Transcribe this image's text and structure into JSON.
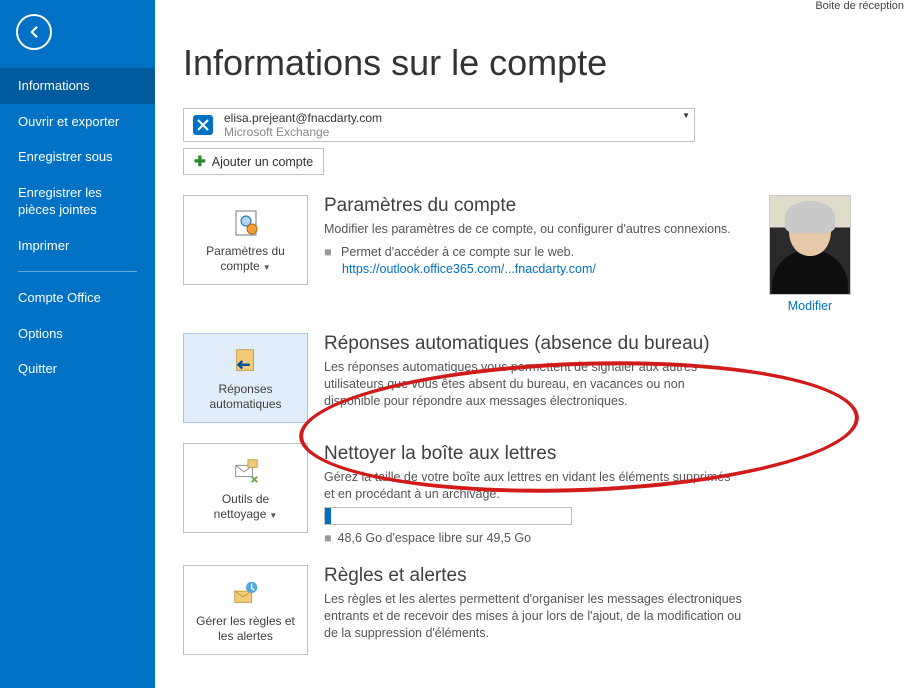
{
  "topRight": "Boite de réception",
  "sidebar": {
    "items": [
      "Informations",
      "Ouvrir et exporter",
      "Enregistrer sous",
      "Enregistrer les pièces jointes",
      "Imprimer",
      "Compte Office",
      "Options",
      "Quitter"
    ]
  },
  "title": "Informations sur le compte",
  "account": {
    "email": "elisa.prejeant@fnacdarty.com",
    "type": "Microsoft Exchange",
    "addBtn": "Ajouter un compte"
  },
  "avatar": {
    "modifyLink": "Modifier"
  },
  "secSettings": {
    "btn": "Paramètres du compte",
    "title": "Paramètres du compte",
    "desc": "Modifier les paramètres de ce compte, ou configurer d'autres connexions.",
    "bullet": "Permet d'accéder à ce compte sur le web.",
    "link": "https://outlook.office365.com/...fnacdarty.com/"
  },
  "secAuto": {
    "btn": "Réponses automatiques",
    "title": "Réponses automatiques (absence du bureau)",
    "desc": "Les réponses automatiques vous permettent de signaler aux autres utilisateurs que vous êtes absent du bureau, en vacances ou non disponible pour répondre aux messages électroniques."
  },
  "secClean": {
    "btn": "Outils de nettoyage",
    "title": "Nettoyer la boîte aux lettres",
    "desc": "Gérez la taille de votre boîte aux lettres en vidant les éléments supprimés et en procédant à un archivage.",
    "storage": "48,6 Go d'espace libre sur 49,5 Go"
  },
  "secRules": {
    "btn": "Gérer les règles et les alertes",
    "title": "Règles et alertes",
    "desc": "Les règles et les alertes permettent d'organiser les messages électroniques entrants et de recevoir des mises à jour lors de l'ajout, de la modification ou de la suppression d'éléments."
  }
}
